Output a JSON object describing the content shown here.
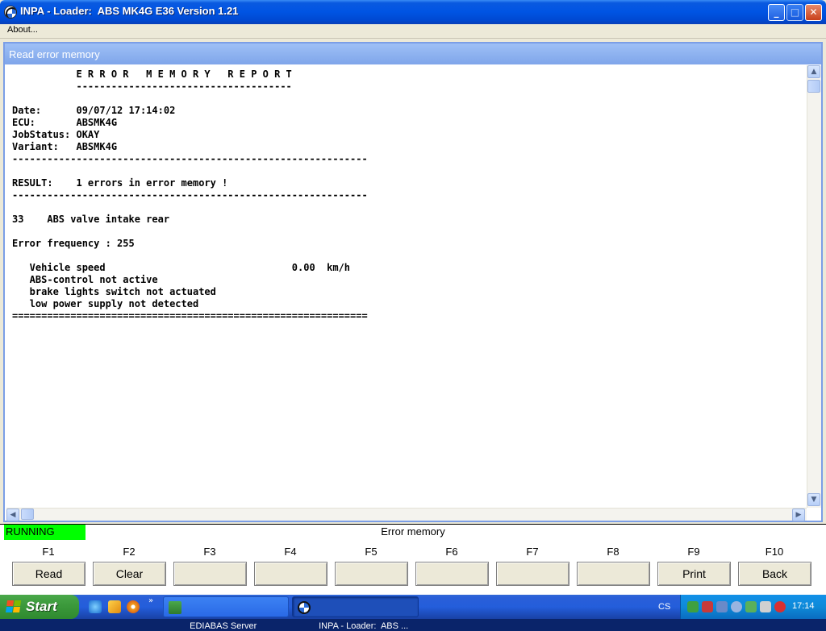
{
  "window": {
    "title": "INPA - Loader:  ABS MK4G E36 Version 1.21",
    "minimize_symbol": "_",
    "maximize_symbol": "□",
    "close_symbol": "✕"
  },
  "menu": {
    "about": "About..."
  },
  "panel": {
    "title": "Read error memory"
  },
  "report": {
    "lines": [
      "           E R R O R   M E M O R Y   R E P O R T",
      "           -------------------------------------",
      "",
      "Date:      09/07/12 17:14:02",
      "ECU:       ABSMK4G",
      "JobStatus: OKAY",
      "Variant:   ABSMK4G",
      "-------------------------------------------------------------",
      "",
      "RESULT:    1 errors in error memory !",
      "-------------------------------------------------------------",
      "",
      "33    ABS valve intake rear",
      "",
      "Error frequency : 255",
      "",
      "   Vehicle speed                                0.00  km/h",
      "   ABS-control not active",
      "   brake lights switch not actuated",
      "   low power supply not detected",
      "============================================================="
    ]
  },
  "scrollbars": {
    "up": "▲",
    "down": "▼",
    "left": "◀",
    "right": "▶"
  },
  "status": {
    "state": "RUNNING",
    "state_color": "#00ff00",
    "screen": "Error memory"
  },
  "function_keys": [
    {
      "key": "F1",
      "label": "Read"
    },
    {
      "key": "F2",
      "label": "Clear"
    },
    {
      "key": "F3",
      "label": ""
    },
    {
      "key": "F4",
      "label": ""
    },
    {
      "key": "F5",
      "label": ""
    },
    {
      "key": "F6",
      "label": ""
    },
    {
      "key": "F7",
      "label": ""
    },
    {
      "key": "F8",
      "label": ""
    },
    {
      "key": "F9",
      "label": "Print"
    },
    {
      "key": "F10",
      "label": "Back"
    }
  ],
  "taskbar": {
    "start_label": "Start",
    "chevron": "»",
    "tasks": [
      {
        "label": "EDIABAS Server",
        "icon": "ediabas-icon"
      },
      {
        "label": "INPA - Loader:  ABS ...",
        "icon": "bmw-icon"
      }
    ],
    "language": "CS",
    "clock": "17:14"
  }
}
